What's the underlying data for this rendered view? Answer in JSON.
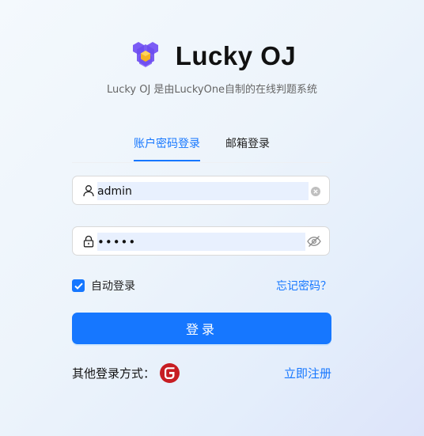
{
  "app": {
    "title": "Lucky OJ",
    "subtitle": "Lucky OJ 是由LuckyOne自制的在线判题系统"
  },
  "tabs": [
    {
      "label": "账户密码登录",
      "active": true
    },
    {
      "label": "邮箱登录",
      "active": false
    }
  ],
  "form": {
    "username": {
      "value": "admin",
      "icon": "user-icon"
    },
    "password": {
      "value": "•••••",
      "icon": "lock-icon"
    },
    "remember": {
      "label": "自动登录",
      "checked": true
    },
    "forgot_label": "忘记密码？",
    "submit_label": "登录",
    "other_login_label": "其他登录方式：",
    "other_login_icon": "gitee-icon",
    "register_label": "立即注册"
  },
  "colors": {
    "primary": "#1677ff",
    "logo_purple": "#7b5cf5",
    "logo_gold": "#f5b323",
    "gitee_red": "#c71d23"
  }
}
